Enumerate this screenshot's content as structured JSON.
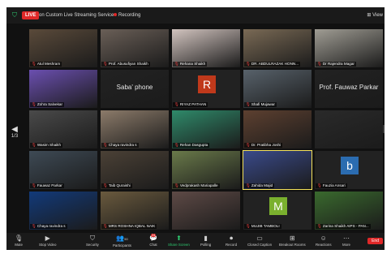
{
  "topbar": {
    "live": "LIVE",
    "stream_title": "on Custom Live Streaming Service",
    "recording": "Recording",
    "view": "View"
  },
  "nav": {
    "left_arrow": "◀",
    "page": "1/3"
  },
  "participants": [
    {
      "name": "Atul Meshram",
      "color": "#5a4a3a"
    },
    {
      "name": "Prof. Abusufiyan Shaikh",
      "color": "#6a5f57"
    },
    {
      "name": "Rehana Shaikh",
      "color": "#d2c4bf"
    },
    {
      "name": "DR. ABDULRAZAK HONN...",
      "color": "#7a6a55"
    },
    {
      "name": "Dr Rajendra Magar",
      "color": "#a09d94"
    },
    {
      "name": "Zohra Salvekar",
      "color": "#6b4fb0"
    },
    {
      "name": "Saba' phone",
      "color": "#222222"
    },
    {
      "name": "RIYAZ PATHAN",
      "color": "#222222",
      "avatar": "R",
      "avatar_color": "#c0391b"
    },
    {
      "name": "Shafi Mujawar",
      "color": "#58626b"
    },
    {
      "name": "Prof. Fauwaz Parkar",
      "color": "#222222"
    },
    {
      "name": "Wasim Shaikh",
      "color": "#4a4a4a"
    },
    {
      "name": "Chaya ravindra s",
      "color": "#8c7b6a"
    },
    {
      "name": "Rehan Dasgupta",
      "color": "#2f8a6a"
    },
    {
      "name": "Dr. Pratibha Joshi",
      "color": "#5d4030"
    },
    {
      "name": "",
      "color": "#2a2a2a"
    },
    {
      "name": "Fauwaz Parkar",
      "color": "#3e4a55"
    },
    {
      "name": "Taib Quraishi",
      "color": "#4b4136"
    },
    {
      "name": "Vedprakash Mariapalle",
      "color": "#6a7a4a"
    },
    {
      "name": "Zahida Majid",
      "color": "#3a4a8a"
    },
    {
      "name": "Fauzia Ansari",
      "color": "#222222",
      "avatar": "b",
      "avatar_color": "#2b6cb0"
    },
    {
      "name": "Chaya ravindra s",
      "color": "#123a7a"
    },
    {
      "name": "MRS ROSHNA IQBAL NAIK",
      "color": "#6a5a3e"
    },
    {
      "name": "",
      "color": "#5e4a46"
    },
    {
      "name": "MUJIB TAMBOLI",
      "color": "#222222",
      "avatar": "M",
      "avatar_color": "#7ab02e"
    },
    {
      "name": "Zarina Shaikh AIPS - PAN...",
      "color": "#3a6a2e"
    }
  ],
  "toolbar": {
    "mute": "Mute",
    "stop_video": "Stop Video",
    "security": "Security",
    "participants": "Participants",
    "participants_count": "50",
    "chat": "Chat",
    "share_screen": "Share Screen",
    "polling": "Polling",
    "record": "Record",
    "closed_caption": "Closed Caption",
    "breakout_rooms": "Breakout Rooms",
    "reactions": "Reactions",
    "more": "More",
    "end": "End",
    "chat_badge": "24"
  },
  "colors": {
    "live": "#e02828",
    "active_speaker": "#f5e25a",
    "share": "#2ecc71"
  }
}
